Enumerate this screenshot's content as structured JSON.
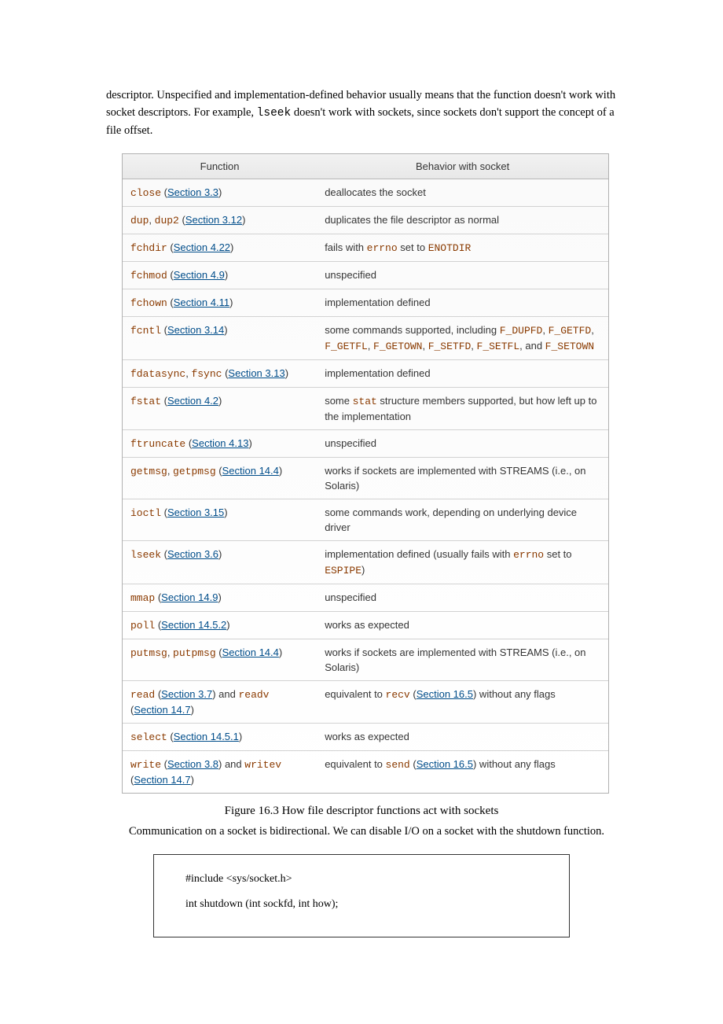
{
  "intro": {
    "p1_a": "descriptor. Unspecified and implementation-defined behavior usually means that the function doesn't work with socket descriptors. For example, ",
    "p1_code": "lseek",
    "p1_b": " doesn't work with sockets, since sockets don't support the concept of a file offset."
  },
  "table": {
    "headers": {
      "fn": "Function",
      "bh": "Behavior with socket"
    },
    "rows": [
      {
        "fn": [
          {
            "t": "code",
            "v": "close"
          },
          {
            "t": "txt",
            "v": " ("
          },
          {
            "t": "lnk",
            "v": "Section 3.3"
          },
          {
            "t": "txt",
            "v": ")"
          }
        ],
        "bh": [
          {
            "t": "txt",
            "v": "deallocates the socket"
          }
        ]
      },
      {
        "fn": [
          {
            "t": "code",
            "v": "dup"
          },
          {
            "t": "txt",
            "v": ", "
          },
          {
            "t": "code",
            "v": "dup2"
          },
          {
            "t": "txt",
            "v": " ("
          },
          {
            "t": "lnk",
            "v": "Section 3.12"
          },
          {
            "t": "txt",
            "v": ")"
          }
        ],
        "bh": [
          {
            "t": "txt",
            "v": "duplicates the file descriptor as normal"
          }
        ]
      },
      {
        "fn": [
          {
            "t": "code",
            "v": "fchdir"
          },
          {
            "t": "txt",
            "v": " ("
          },
          {
            "t": "lnk",
            "v": "Section 4.22"
          },
          {
            "t": "txt",
            "v": ")"
          }
        ],
        "bh": [
          {
            "t": "txt",
            "v": "fails with "
          },
          {
            "t": "code",
            "v": "errno"
          },
          {
            "t": "txt",
            "v": " set to "
          },
          {
            "t": "code",
            "v": "ENOTDIR"
          }
        ]
      },
      {
        "fn": [
          {
            "t": "code",
            "v": "fchmod"
          },
          {
            "t": "txt",
            "v": " ("
          },
          {
            "t": "lnk",
            "v": "Section 4.9"
          },
          {
            "t": "txt",
            "v": ")"
          }
        ],
        "bh": [
          {
            "t": "txt",
            "v": "unspecified"
          }
        ]
      },
      {
        "fn": [
          {
            "t": "code",
            "v": "fchown"
          },
          {
            "t": "txt",
            "v": " ("
          },
          {
            "t": "lnk",
            "v": "Section 4.11"
          },
          {
            "t": "txt",
            "v": ")"
          }
        ],
        "bh": [
          {
            "t": "txt",
            "v": "implementation defined"
          }
        ]
      },
      {
        "fn": [
          {
            "t": "code",
            "v": "fcntl"
          },
          {
            "t": "txt",
            "v": " ("
          },
          {
            "t": "lnk",
            "v": "Section 3.14"
          },
          {
            "t": "txt",
            "v": ")"
          }
        ],
        "bh": [
          {
            "t": "txt",
            "v": "some commands supported, including "
          },
          {
            "t": "code",
            "v": "F_DUPFD"
          },
          {
            "t": "txt",
            "v": ", "
          },
          {
            "t": "code",
            "v": "F_GETFD"
          },
          {
            "t": "txt",
            "v": ", "
          },
          {
            "t": "code",
            "v": "F_GETFL"
          },
          {
            "t": "txt",
            "v": ", "
          },
          {
            "t": "code",
            "v": "F_GETOWN"
          },
          {
            "t": "txt",
            "v": ", "
          },
          {
            "t": "code",
            "v": "F_SETFD"
          },
          {
            "t": "txt",
            "v": ", "
          },
          {
            "t": "code",
            "v": "F_SETFL"
          },
          {
            "t": "txt",
            "v": ", and "
          },
          {
            "t": "code",
            "v": "F_SETOWN"
          }
        ]
      },
      {
        "fn": [
          {
            "t": "code",
            "v": "fdatasync"
          },
          {
            "t": "txt",
            "v": ", "
          },
          {
            "t": "code",
            "v": "fsync"
          },
          {
            "t": "txt",
            "v": " ("
          },
          {
            "t": "lnk",
            "v": "Section 3.13"
          },
          {
            "t": "txt",
            "v": ")"
          }
        ],
        "bh": [
          {
            "t": "txt",
            "v": "implementation defined"
          }
        ]
      },
      {
        "fn": [
          {
            "t": "code",
            "v": "fstat"
          },
          {
            "t": "txt",
            "v": " ("
          },
          {
            "t": "lnk",
            "v": "Section 4.2"
          },
          {
            "t": "txt",
            "v": ")"
          }
        ],
        "bh": [
          {
            "t": "txt",
            "v": "some "
          },
          {
            "t": "code",
            "v": "stat"
          },
          {
            "t": "txt",
            "v": " structure members supported, but how left up to the implementation"
          }
        ]
      },
      {
        "fn": [
          {
            "t": "code",
            "v": "ftruncate"
          },
          {
            "t": "txt",
            "v": " ("
          },
          {
            "t": "lnk",
            "v": "Section 4.13"
          },
          {
            "t": "txt",
            "v": ")"
          }
        ],
        "bh": [
          {
            "t": "txt",
            "v": "unspecified"
          }
        ]
      },
      {
        "fn": [
          {
            "t": "code",
            "v": "getmsg"
          },
          {
            "t": "txt",
            "v": ", "
          },
          {
            "t": "code",
            "v": "getpmsg"
          },
          {
            "t": "txt",
            "v": " ("
          },
          {
            "t": "lnk",
            "v": "Section 14.4"
          },
          {
            "t": "txt",
            "v": ")"
          }
        ],
        "bh": [
          {
            "t": "txt",
            "v": "works if sockets are implemented with STREAMS (i.e., on Solaris)"
          }
        ]
      },
      {
        "fn": [
          {
            "t": "code",
            "v": "ioctl"
          },
          {
            "t": "txt",
            "v": " ("
          },
          {
            "t": "lnk",
            "v": "Section 3.15"
          },
          {
            "t": "txt",
            "v": ")"
          }
        ],
        "bh": [
          {
            "t": "txt",
            "v": "some commands work, depending on underlying device driver"
          }
        ]
      },
      {
        "fn": [
          {
            "t": "code",
            "v": "lseek"
          },
          {
            "t": "txt",
            "v": " ("
          },
          {
            "t": "lnk",
            "v": "Section 3.6"
          },
          {
            "t": "txt",
            "v": ")"
          }
        ],
        "bh": [
          {
            "t": "txt",
            "v": "implementation defined (usually fails with "
          },
          {
            "t": "code",
            "v": "errno"
          },
          {
            "t": "txt",
            "v": " set to "
          },
          {
            "t": "code",
            "v": "ESPIPE"
          },
          {
            "t": "txt",
            "v": ")"
          }
        ]
      },
      {
        "fn": [
          {
            "t": "code",
            "v": "mmap"
          },
          {
            "t": "txt",
            "v": " ("
          },
          {
            "t": "lnk",
            "v": "Section 14.9"
          },
          {
            "t": "txt",
            "v": ")"
          }
        ],
        "bh": [
          {
            "t": "txt",
            "v": "unspecified"
          }
        ]
      },
      {
        "fn": [
          {
            "t": "code",
            "v": "poll"
          },
          {
            "t": "txt",
            "v": " ("
          },
          {
            "t": "lnk",
            "v": "Section 14.5.2"
          },
          {
            "t": "txt",
            "v": ")"
          }
        ],
        "bh": [
          {
            "t": "txt",
            "v": "works as expected"
          }
        ]
      },
      {
        "fn": [
          {
            "t": "code",
            "v": "putmsg"
          },
          {
            "t": "txt",
            "v": ", "
          },
          {
            "t": "code",
            "v": "putpmsg"
          },
          {
            "t": "txt",
            "v": " ("
          },
          {
            "t": "lnk",
            "v": "Section 14.4"
          },
          {
            "t": "txt",
            "v": ")"
          }
        ],
        "bh": [
          {
            "t": "txt",
            "v": "works if sockets are implemented with STREAMS (i.e., on Solaris)"
          }
        ]
      },
      {
        "fn": [
          {
            "t": "code",
            "v": "read"
          },
          {
            "t": "txt",
            "v": " ("
          },
          {
            "t": "lnk",
            "v": "Section 3.7"
          },
          {
            "t": "txt",
            "v": ") and "
          },
          {
            "t": "code",
            "v": "readv"
          },
          {
            "t": "txt",
            "v": " ("
          },
          {
            "t": "lnk",
            "v": "Section 14.7"
          },
          {
            "t": "txt",
            "v": ")"
          }
        ],
        "bh": [
          {
            "t": "txt",
            "v": "equivalent to "
          },
          {
            "t": "code",
            "v": "recv"
          },
          {
            "t": "txt",
            "v": " ("
          },
          {
            "t": "lnk",
            "v": "Section 16.5"
          },
          {
            "t": "txt",
            "v": ") without any flags"
          }
        ]
      },
      {
        "fn": [
          {
            "t": "code",
            "v": "select"
          },
          {
            "t": "txt",
            "v": " ("
          },
          {
            "t": "lnk",
            "v": "Section 14.5.1"
          },
          {
            "t": "txt",
            "v": ")"
          }
        ],
        "bh": [
          {
            "t": "txt",
            "v": "works as expected"
          }
        ]
      },
      {
        "fn": [
          {
            "t": "code",
            "v": "write"
          },
          {
            "t": "txt",
            "v": " ("
          },
          {
            "t": "lnk",
            "v": "Section 3.8"
          },
          {
            "t": "txt",
            "v": ") and "
          },
          {
            "t": "code",
            "v": "writev"
          },
          {
            "t": "txt",
            "v": " ("
          },
          {
            "t": "lnk",
            "v": "Section 14.7"
          },
          {
            "t": "txt",
            "v": ")"
          }
        ],
        "bh": [
          {
            "t": "txt",
            "v": "equivalent to "
          },
          {
            "t": "code",
            "v": "send"
          },
          {
            "t": "txt",
            "v": " ("
          },
          {
            "t": "lnk",
            "v": "Section 16.5"
          },
          {
            "t": "txt",
            "v": ") without any flags"
          }
        ]
      }
    ]
  },
  "caption": "Figure 16.3 How file descriptor functions act with sockets",
  "para2": "Communication on a socket is bidirectional. We can disable I/O on a socket with the shutdown function.",
  "codebox": {
    "l1": "#include <sys/socket.h>",
    "l2": "int shutdown (int sockfd, int how);"
  }
}
